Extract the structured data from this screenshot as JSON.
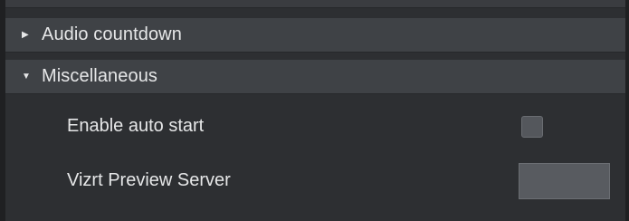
{
  "sections": [
    {
      "label": "Audio countdown",
      "expanded": false,
      "arrow_icon": "triangle-right-icon"
    },
    {
      "label": "Miscellaneous",
      "expanded": true,
      "arrow_icon": "triangle-down-icon"
    }
  ],
  "misc": {
    "auto_start": {
      "label": "Enable auto start",
      "checked": false
    },
    "preview_server": {
      "label": "Vizrt Preview Server",
      "value": ""
    }
  },
  "glyphs": {
    "collapsed": "▶",
    "expanded": "▼"
  }
}
